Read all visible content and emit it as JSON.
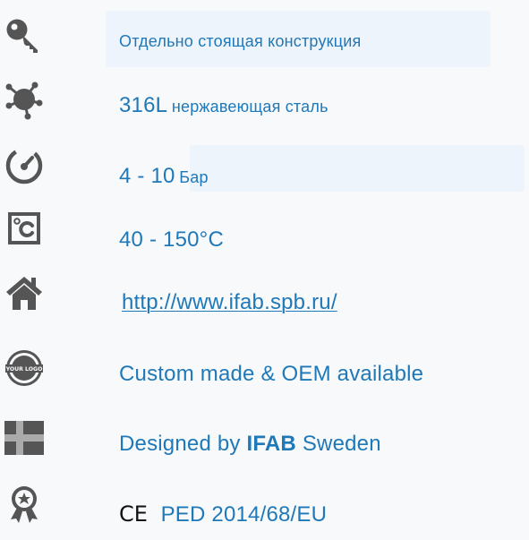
{
  "items": [
    {
      "icon": "key-icon",
      "text": "Отдельно стоящая конструкция"
    },
    {
      "icon": "network-node-icon",
      "prefix": "316L",
      "text": "нержавеющая сталь"
    },
    {
      "icon": "pressure-gauge-icon",
      "prefix": "4 - 10",
      "text": "Бар"
    },
    {
      "icon": "temperature-celsius-icon",
      "text": "40 - 150°C"
    },
    {
      "icon": "home-icon",
      "text": "http://www.ifab.spb.ru/"
    },
    {
      "icon": "your-logo-badge-icon",
      "text": "Custom made & OEM available",
      "badge_text": "YOUR LOGO"
    },
    {
      "icon": "sweden-flag-icon",
      "prefix": "Designed by",
      "strong": "IFAB",
      "suffix": "Sweden"
    },
    {
      "icon": "award-star-icon",
      "ce": "CE",
      "text": "PED 2014/68/EU"
    }
  ],
  "colors": {
    "text": "#1f78b7",
    "icon": "#555555",
    "ce": "#111111"
  }
}
